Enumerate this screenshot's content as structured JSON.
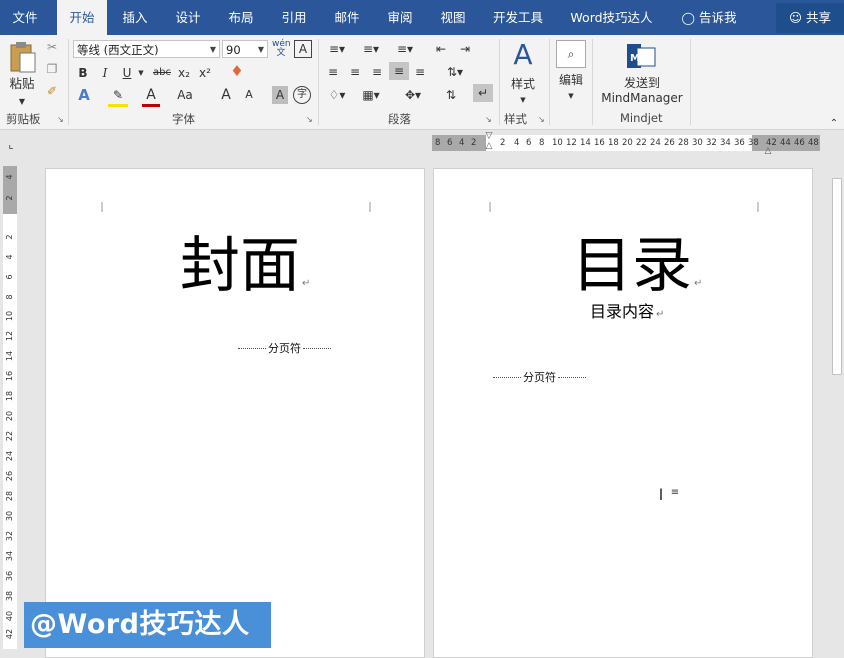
{
  "tabs": [
    "文件",
    "开始",
    "插入",
    "设计",
    "布局",
    "引用",
    "邮件",
    "审阅",
    "视图",
    "开发工具",
    "Word技巧达人"
  ],
  "active_tab": "开始",
  "tell_me": "告诉我",
  "share_label": "共享",
  "ribbon": {
    "clipboard": {
      "paste_label": "粘贴",
      "group_label": "剪贴板"
    },
    "font": {
      "font_name": "等线 (西文正文)",
      "font_size": "90",
      "group_label": "字体",
      "wen_label": "wén",
      "char_border_label": "A",
      "bold": "B",
      "italic": "I",
      "underline": "U",
      "strike": "abc",
      "subscript": "x₂",
      "superscript": "x²",
      "text_effect": "A",
      "font_color": "A",
      "change_case": "Aa",
      "grow_font": "A",
      "shrink_font": "A",
      "char_shading": "A",
      "enclose_char": "字"
    },
    "paragraph": {
      "group_label": "段落"
    },
    "styles": {
      "label": "样式",
      "group_label": "样式"
    },
    "editing": {
      "label": "编辑"
    },
    "mindjet": {
      "line1": "发送到",
      "line2": "MindManager",
      "group_label": "Mindjet"
    }
  },
  "ruler_h_numbers": [
    "8",
    "6",
    "4",
    "2",
    "2",
    "4",
    "6",
    "8",
    "10",
    "12",
    "14",
    "16",
    "18",
    "20",
    "22",
    "24",
    "26",
    "28",
    "30",
    "32",
    "34",
    "36",
    "38",
    "42",
    "44",
    "46",
    "48"
  ],
  "ruler_v_numbers": [
    "4",
    "2",
    "2",
    "4",
    "6",
    "8",
    "10",
    "12",
    "14",
    "16",
    "18",
    "20",
    "22",
    "24",
    "26",
    "28",
    "30",
    "32",
    "34",
    "36",
    "38",
    "40",
    "42"
  ],
  "pages": [
    {
      "title": "封面",
      "page_break": "分页符"
    },
    {
      "title": "目录",
      "subtitle": "目录内容",
      "page_break": "分页符"
    }
  ],
  "paragraph_mark": "↵",
  "watermark": "@Word技巧达人",
  "colors": {
    "tab_bar": "#2b579a",
    "ribbon": "#f3f3f3",
    "watermark_bg": "#4a90d9"
  }
}
